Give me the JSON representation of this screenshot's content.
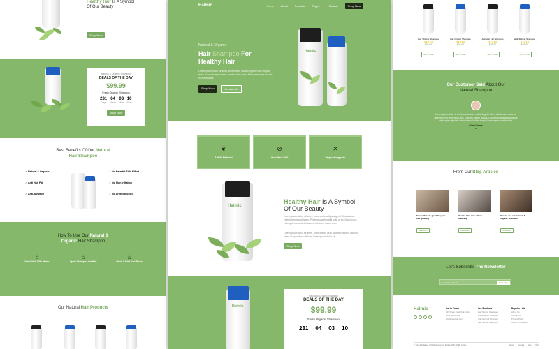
{
  "brand": "Haimic",
  "nav": {
    "items": [
      "Home",
      "About",
      "Products",
      "Pages",
      "Contact"
    ],
    "cta": "Shop Now"
  },
  "hero": {
    "kicker": "Natural & Organic",
    "title_a": "Hair",
    "title_b": "Shampoo",
    "title_c": "For",
    "title_d": "Healthy Hair",
    "body": "Lorem ipsum dolor sit amet, consectetur adipiscing elit. Nam feugiat tellus in mauris eget lorem, suscipit vitae risus. Maecenas vitae mauris in, lorem dolor.",
    "btn_shop": "Shop Now",
    "btn_contact": "Contact Us"
  },
  "features": [
    {
      "icon": "leaf-icon",
      "glyph": "❦",
      "label": "100% Natural"
    },
    {
      "icon": "no-hair-fall-icon",
      "glyph": "⊘",
      "label": "Anti Hair Fall"
    },
    {
      "icon": "cross-icon",
      "glyph": "✕",
      "label": "Hypoallergenic"
    }
  ],
  "symbol": {
    "title_a": "Healthy Hair",
    "title_b": "Is A Symbol",
    "title_c": "Of Our Beauty",
    "body1": "Lorem ipsum dolor sit amet, consectetur adipiscing elit. Duis aliquet, enim lorem neque lacus. Pellentesque fringilla nulla at ex. Nam luctus enim quis consectetur lorem, vel lorem ipsum enim.",
    "body2": "Lorem ipsum dolor sit amet, consectetur. Duis sit amet tortor in lacus ut enim. Suspendisse ultricies lorem ipsum dolor sit.",
    "btn": "Shop Now"
  },
  "deal": {
    "kicker": "Natural & Organic Shampoo",
    "title": "DEALS OF THE DAY",
    "price": "$99.99",
    "product": "Fresh Organic Shampoo",
    "countdown": [
      {
        "v": "231",
        "l": "Days"
      },
      {
        "v": "04",
        "l": "Hours"
      },
      {
        "v": "03",
        "l": "Mins"
      },
      {
        "v": "10",
        "l": "Secs"
      }
    ],
    "btn": "Shop Now"
  },
  "left": {
    "symbol_title_a": "Healthy Hair",
    "symbol_title_b": "Is A Symbol",
    "symbol_title_c": "Of Our Beauty",
    "benefits_title_a": "Best Benefits Of Our",
    "benefits_title_b": "Natural",
    "benefits_title_c": "Hair Shampoo",
    "benefits_left": [
      "Natural & Organic",
      "Anti Hair Fall",
      "Anti-dandruff"
    ],
    "benefits_right": [
      "No Harmful Side Effect",
      "No Skin Irritation",
      "No Artificial Smell"
    ],
    "howto_a": "How To Use Our",
    "howto_b": "Natural &",
    "howto_c": "Organic",
    "howto_d": "Hair Shampoo",
    "steps": [
      "Wash Hair With Water",
      "Apply Shampoo On Hair",
      "Wash It Well And Rinse"
    ],
    "products_a": "Our Natural",
    "products_b": "Hair Products"
  },
  "right": {
    "products": [
      {
        "name": "Hair Shining Shampoo",
        "price": "$49.00"
      },
      {
        "name": "Hair Growth Shampoo",
        "price": "$49.00"
      },
      {
        "name": "Anti Hair Fall Shampoo",
        "price": "$49.00"
      },
      {
        "name": "Hair Shining Shampoo",
        "price": "$49.00"
      }
    ],
    "add_to_cart": "Add To Cart",
    "stars": "★★★★★",
    "testimonial_a": "Our Customer Said",
    "testimonial_b": "About Our",
    "testimonial_c": "Natural Shampoo",
    "testimonial_body": "Lorem ipsum dolor sit amet, consectetur adipiscing elit. Nunc ultricies sem ante, at bibendum leo fermentum quis. Duis vel sapien cursus. Curabitur consequat vehicula dolor, quis vulputate ipsum lorem. Nullam feugiat lorem eget molestie dolor.",
    "testimonial_name": "Client Name",
    "blog_a": "From Our",
    "blog_b": "Blog Articles",
    "posts": [
      {
        "title": "Foods that are good for your hair growing"
      },
      {
        "title": "How to take care of hair naturally"
      },
      {
        "title": "How to use our natural & organic shampoo"
      }
    ],
    "read_more": "Read More",
    "newsletter_a": "Let's Subscribe",
    "newsletter_b": "The Newsletter",
    "newsletter_placeholder": "Enter Your Email",
    "newsletter_btn": "Subscribe",
    "footer_brand": "Hairnic",
    "footer_cols": [
      "Get In Touch",
      "Our Products",
      "Popular Link"
    ],
    "footer_contact": [
      "123 Street, New York, USA",
      "+012 345 67890",
      "info@example.com"
    ],
    "footer_products": [
      "Hair Shining Shampoo",
      "Anti-dandruff Shampoo",
      "Anti Hair Fall Shampoo",
      "Hair Growth Shampoo",
      "Anti Lice Shampoo"
    ],
    "footer_links": [
      "About Us",
      "Contact Us",
      "Privacy Policy",
      "Terms & Condition",
      "Career"
    ],
    "copyright": "© Your Site Name, All Right Reserved. Designed By HTML Codex",
    "bottom_links": [
      "Home",
      "Cookies",
      "Help",
      "FAQs"
    ]
  },
  "colors": {
    "green": "#86b86b",
    "accent": "#7aa960",
    "dark": "#1e2a16",
    "cap_blue": "#1f5fbf"
  }
}
